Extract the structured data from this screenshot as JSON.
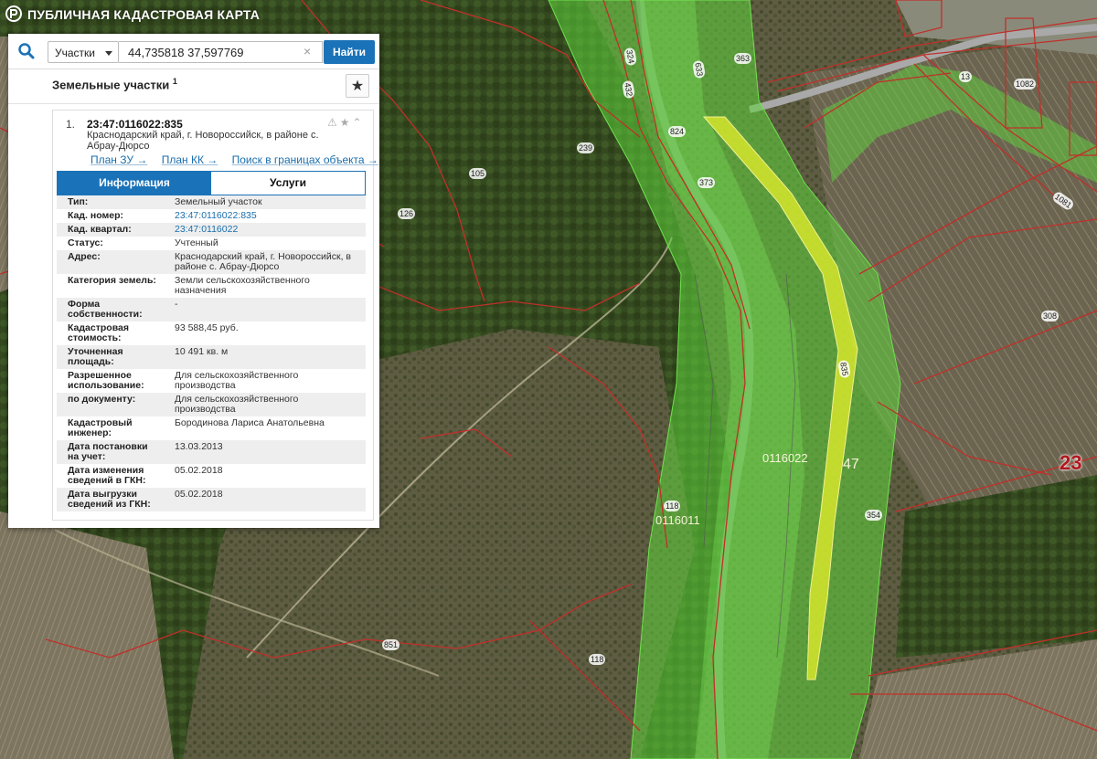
{
  "app": {
    "title": "ПУБЛИЧНАЯ КАДАСТРОВАЯ КАРТА"
  },
  "search": {
    "type_label": "Участки",
    "query_value": "44,735818 37,597769",
    "find_label": "Найти",
    "clear_glyph": "×"
  },
  "results": {
    "title": "Земельные участки",
    "count": "1",
    "favorite_glyph": "★"
  },
  "parcel": {
    "index": "1.",
    "cadastral_number": "23:47:0116022:835",
    "address_short": "Краснодарский край, г. Новороссийск, в районе с. Абрау-Дюрсо",
    "links": [
      "План ЗУ →",
      "План КК →",
      "Поиск в границах объекта →"
    ],
    "tabs": [
      {
        "label": "Информация",
        "active": true
      },
      {
        "label": "Услуги",
        "active": false
      }
    ],
    "fields": [
      {
        "key": "Тип:",
        "value": "Земельный участок"
      },
      {
        "key": "Кад. номер:",
        "value": "23:47:0116022:835",
        "link": true
      },
      {
        "key": "Кад. квартал:",
        "value": "23:47:0116022",
        "link": true
      },
      {
        "key": "Статус:",
        "value": "Учтенный"
      },
      {
        "key": "Адрес:",
        "value": "Краснодарский край, г. Новороссийск, в районе с. Абрау-Дюрсо"
      },
      {
        "key": "Категория земель:",
        "value": "Земли сельскохозяйственного назначения"
      },
      {
        "key": "Форма собственности:",
        "value": "-"
      },
      {
        "key": "Кадастровая стоимость:",
        "value": "93 588,45 руб."
      },
      {
        "key": "Уточненная площадь:",
        "value": "10 491 кв. м"
      },
      {
        "key": "Разрешенное использование:",
        "value": "Для сельскохозяйственного производства"
      },
      {
        "key": "по документу:",
        "value": "Для сельскохозяйственного производства"
      },
      {
        "key": "Кадастровый инженер:",
        "value": "Бородинова Лариса Анатольевна"
      },
      {
        "key": "Дата постановки на учет:",
        "value": "13.03.2013"
      },
      {
        "key": "Дата изменения сведений в ГКН:",
        "value": "05.02.2018"
      },
      {
        "key": "Дата выгрузки сведений из ГКН:",
        "value": "05.02.2018"
      }
    ]
  },
  "map_labels": {
    "parcel_numbers": [
      "239",
      "105",
      "126",
      "824",
      "373",
      "363",
      "13",
      "1082",
      "1081",
      "308",
      "354",
      "118",
      "851",
      "118",
      "835",
      "324",
      "432",
      "633"
    ],
    "quarter_labels": [
      "0116022",
      "0116011",
      "47"
    ],
    "region": "23"
  },
  "colors": {
    "accent": "#1a72b8",
    "link": "#1a6eab",
    "boundary": "#c0302a",
    "selection": "#e6f02a",
    "zone_green": "#5fd33c"
  }
}
